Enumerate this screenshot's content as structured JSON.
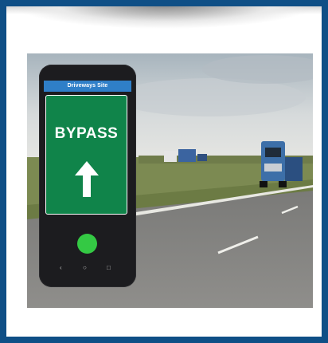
{
  "phone": {
    "header_title": "Driveways Site",
    "sign_text": "BYPASS",
    "sign_arrow": "up-arrow-icon",
    "status_light": "green-dot-icon",
    "nav": {
      "back": "‹",
      "home": "○",
      "recent": "□"
    }
  },
  "colors": {
    "frame": "#0f4f86",
    "phone_header": "#2f7fc8",
    "sign": "#10844a",
    "status_light": "#34c944"
  }
}
